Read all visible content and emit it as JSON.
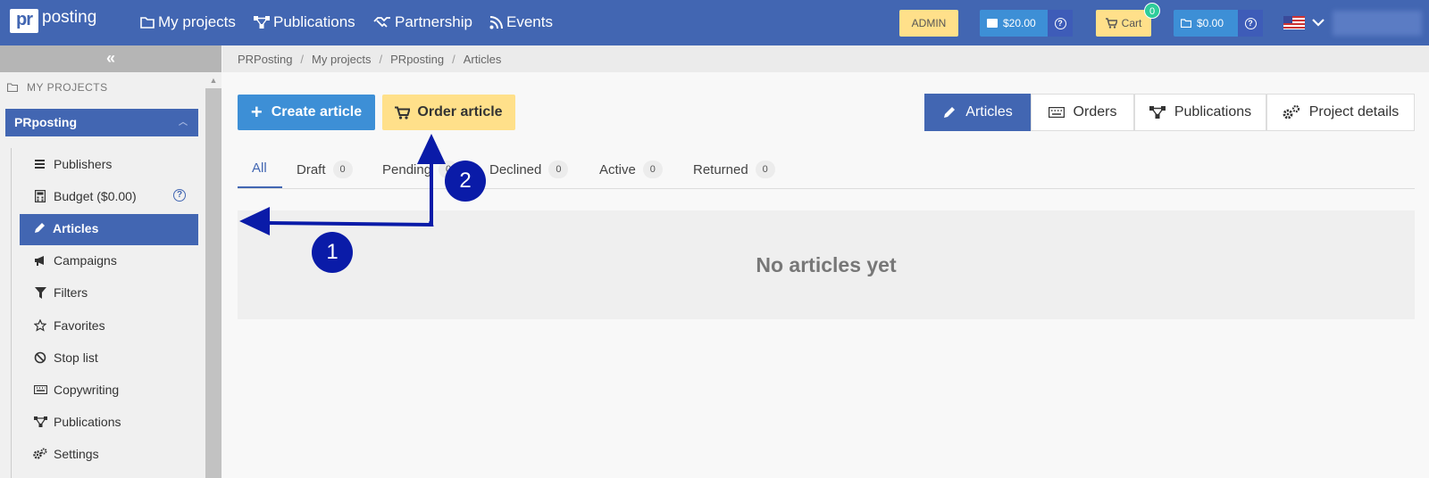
{
  "header": {
    "logo_box": "pr",
    "logo_text": "posting",
    "nav": [
      {
        "label": "My projects",
        "icon": "folder-icon"
      },
      {
        "label": "Publications",
        "icon": "network-icon"
      },
      {
        "label": "Partnership",
        "icon": "handshake-icon"
      },
      {
        "label": "Events",
        "icon": "rss-icon"
      }
    ],
    "admin_label": "ADMIN",
    "balance1": "$20.00",
    "cart_label": "Cart",
    "cart_count": "0",
    "balance2": "$0.00",
    "help_glyph": "?"
  },
  "sidebar": {
    "collapse_glyph": "«",
    "section_title": "MY PROJECTS",
    "project_name": "PRposting",
    "items": [
      {
        "label": "Publishers",
        "icon": "list-icon"
      },
      {
        "label": "Budget ($0.00)",
        "icon": "calculator-icon"
      },
      {
        "label": "Articles",
        "icon": "pencil-icon"
      },
      {
        "label": "Campaigns",
        "icon": "megaphone-icon"
      },
      {
        "label": "Filters",
        "icon": "filter-icon"
      },
      {
        "label": "Favorites",
        "icon": "star-icon"
      },
      {
        "label": "Stop list",
        "icon": "ban-icon"
      },
      {
        "label": "Copywriting",
        "icon": "keyboard-icon"
      },
      {
        "label": "Publications",
        "icon": "network-icon"
      },
      {
        "label": "Settings",
        "icon": "gears-icon"
      }
    ]
  },
  "breadcrumb": [
    "PRPosting",
    "My projects",
    "PRposting",
    "Articles"
  ],
  "actions": {
    "create": "Create article",
    "order": "Order article"
  },
  "segments": [
    {
      "label": "Articles",
      "icon": "pencil-icon",
      "active": true
    },
    {
      "label": "Orders",
      "icon": "keyboard-icon"
    },
    {
      "label": "Publications",
      "icon": "network-icon"
    },
    {
      "label": "Project details",
      "icon": "gears-icon"
    }
  ],
  "tabs": [
    {
      "label": "All",
      "count": ""
    },
    {
      "label": "Draft",
      "count": "0"
    },
    {
      "label": "Pending",
      "count": "0"
    },
    {
      "label": "Declined",
      "count": "0"
    },
    {
      "label": "Active",
      "count": "0"
    },
    {
      "label": "Returned",
      "count": "0"
    }
  ],
  "empty_message": "No articles yet",
  "annotations": {
    "marker1": "1",
    "marker2": "2",
    "color": "#0a1ba8"
  },
  "colors": {
    "brand": "#4266b2",
    "primary_button": "#3d8fd6",
    "warning_button": "#ffe08a",
    "badge_green": "#2ecc9a"
  }
}
